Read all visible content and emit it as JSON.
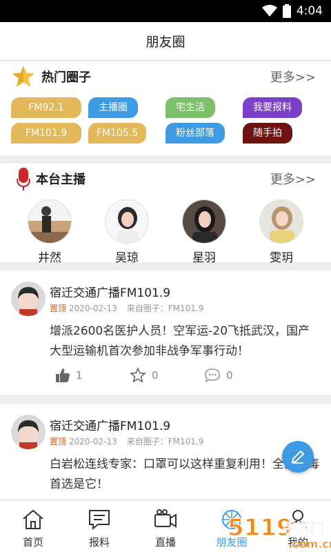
{
  "status": {
    "time": "4:04"
  },
  "title": "朋友圈",
  "hot_circles": {
    "title": "热门圈子",
    "more": "更多>>",
    "tags": [
      {
        "label": "FM92.1",
        "color": "#e3b85a"
      },
      {
        "label": "主播圈",
        "color": "#3e9be3"
      },
      {
        "label": "宅生活",
        "color": "#7cc16a"
      },
      {
        "label": "我要报料",
        "color": "#7b3fc9"
      },
      {
        "label": "FM101.9",
        "color": "#e3b85a"
      },
      {
        "label": "FM105.5",
        "color": "#e3b85a"
      },
      {
        "label": "粉丝部落",
        "color": "#3e9be3"
      },
      {
        "label": "随手拍",
        "color": "#6e1212"
      }
    ]
  },
  "hosts": {
    "title": "本台主播",
    "more": "更多>>",
    "items": [
      {
        "name": "井然"
      },
      {
        "name": "吴琼"
      },
      {
        "name": "星羽"
      },
      {
        "name": "雯玥"
      }
    ]
  },
  "posts": [
    {
      "author": "宿迁交通广播FM101.9",
      "pin": "置顶",
      "date": "2020-02-13",
      "source": "来自圈子：FM101.9",
      "content": "增派2600名医护人员！空军运-20飞抵武汉，国产大型运输机首次参加非战争军事行动！",
      "likes": "1",
      "favorites": "0",
      "comments": "0"
    },
    {
      "author": "宿迁交通广播FM101.9",
      "pin": "置顶",
      "date": "2020-02-13",
      "source": "来自圈子：FM101.9",
      "content": "白岩松连线专家：口罩可以这样重复利用！全部消毒首选是它！"
    }
  ],
  "tabs": [
    {
      "label": "首页",
      "icon": "home-icon"
    },
    {
      "label": "报料",
      "icon": "report-icon"
    },
    {
      "label": "直播",
      "icon": "video-icon"
    },
    {
      "label": "朋友圈",
      "icon": "circle-icon"
    },
    {
      "label": "我的",
      "icon": "user-icon"
    }
  ],
  "watermark": {
    "logo": "5119手游网",
    "url": ".com.cn"
  }
}
